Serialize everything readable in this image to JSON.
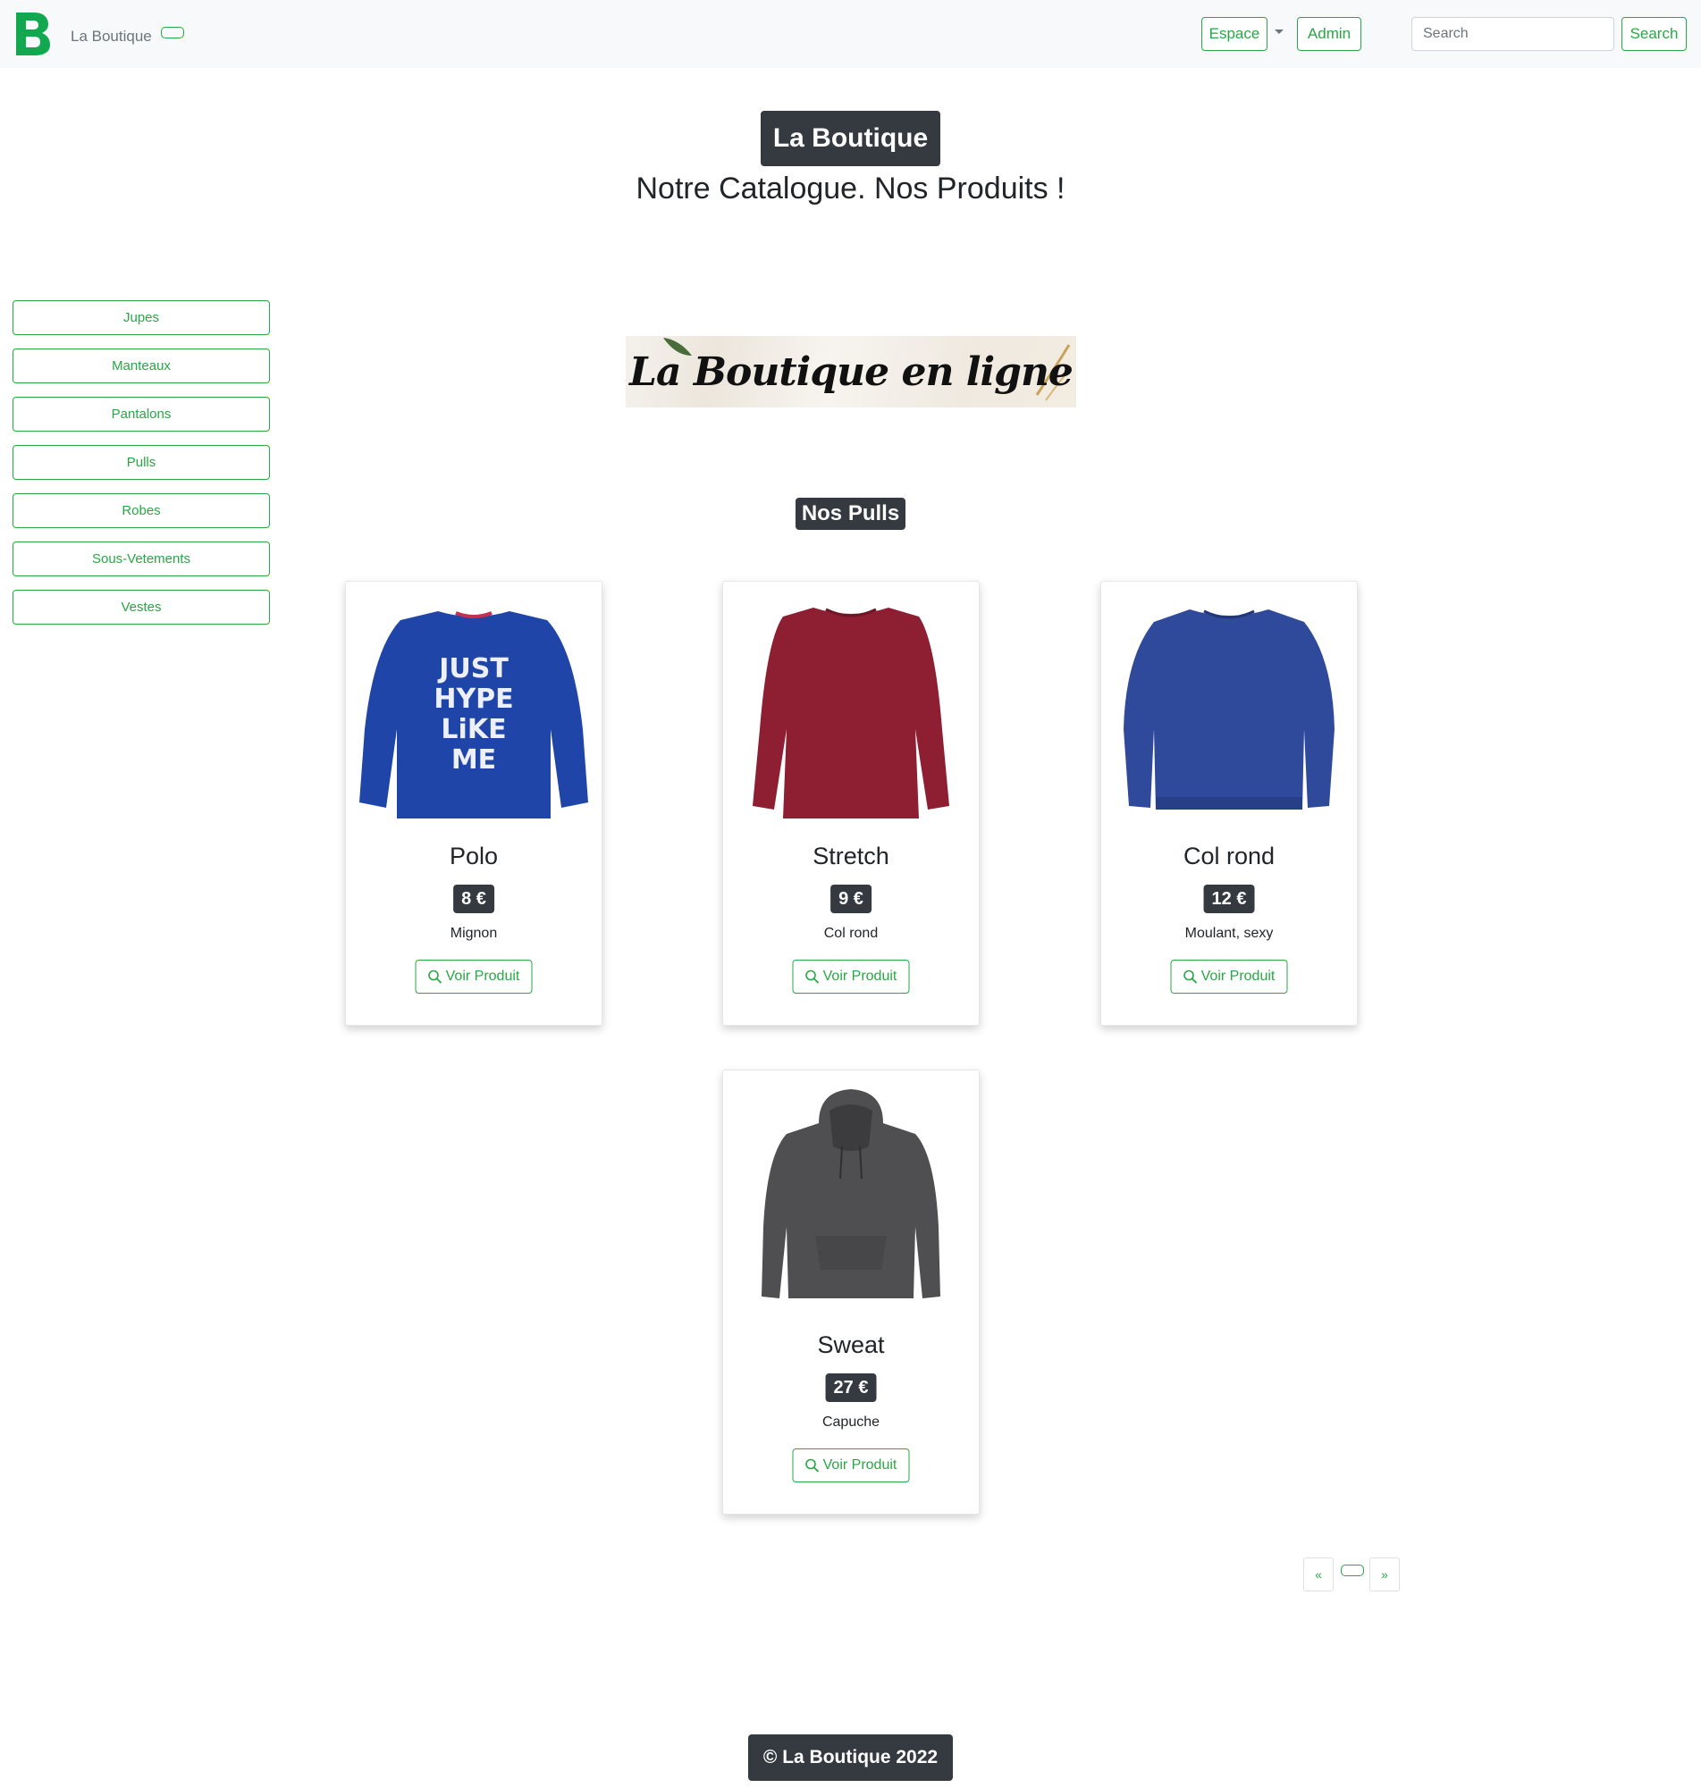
{
  "navbar": {
    "brand": "La Boutique",
    "espace_label": "Espace",
    "admin_label": "Admin",
    "search_placeholder": "Search",
    "search_button": "Search",
    "accent_color": "#28a745"
  },
  "header": {
    "title": "La Boutique",
    "subtitle": "Notre Catalogue. Nos Produits !"
  },
  "sidebar": {
    "categories": [
      "Jupes",
      "Manteaux",
      "Pantalons",
      "Pulls",
      "Robes",
      "Sous-Vetements",
      "Vestes"
    ]
  },
  "banner": {
    "text": "La Boutique en ligne"
  },
  "section": {
    "title": "Nos Pulls"
  },
  "products": [
    {
      "name": "Polo",
      "price": "8 €",
      "description": "Mignon",
      "button": "Voir Produit",
      "image_text": [
        "JUST",
        "HYPE",
        "LiKE",
        "ME"
      ],
      "color": "#1d3fa3"
    },
    {
      "name": "Stretch",
      "price": "9 €",
      "description": "Col rond",
      "button": "Voir Produit",
      "color": "#8e1f33"
    },
    {
      "name": "Col rond",
      "price": "12 €",
      "description": "Moulant, sexy",
      "button": "Voir Produit",
      "color": "#2f4a9a"
    },
    {
      "name": "Sweat",
      "price": "27 €",
      "description": "Capuche",
      "button": "Voir Produit",
      "color": "#4f4f51"
    }
  ],
  "pagination": {
    "prev": "«",
    "next": "»"
  },
  "footer": {
    "text": "© La Boutique 2022"
  }
}
